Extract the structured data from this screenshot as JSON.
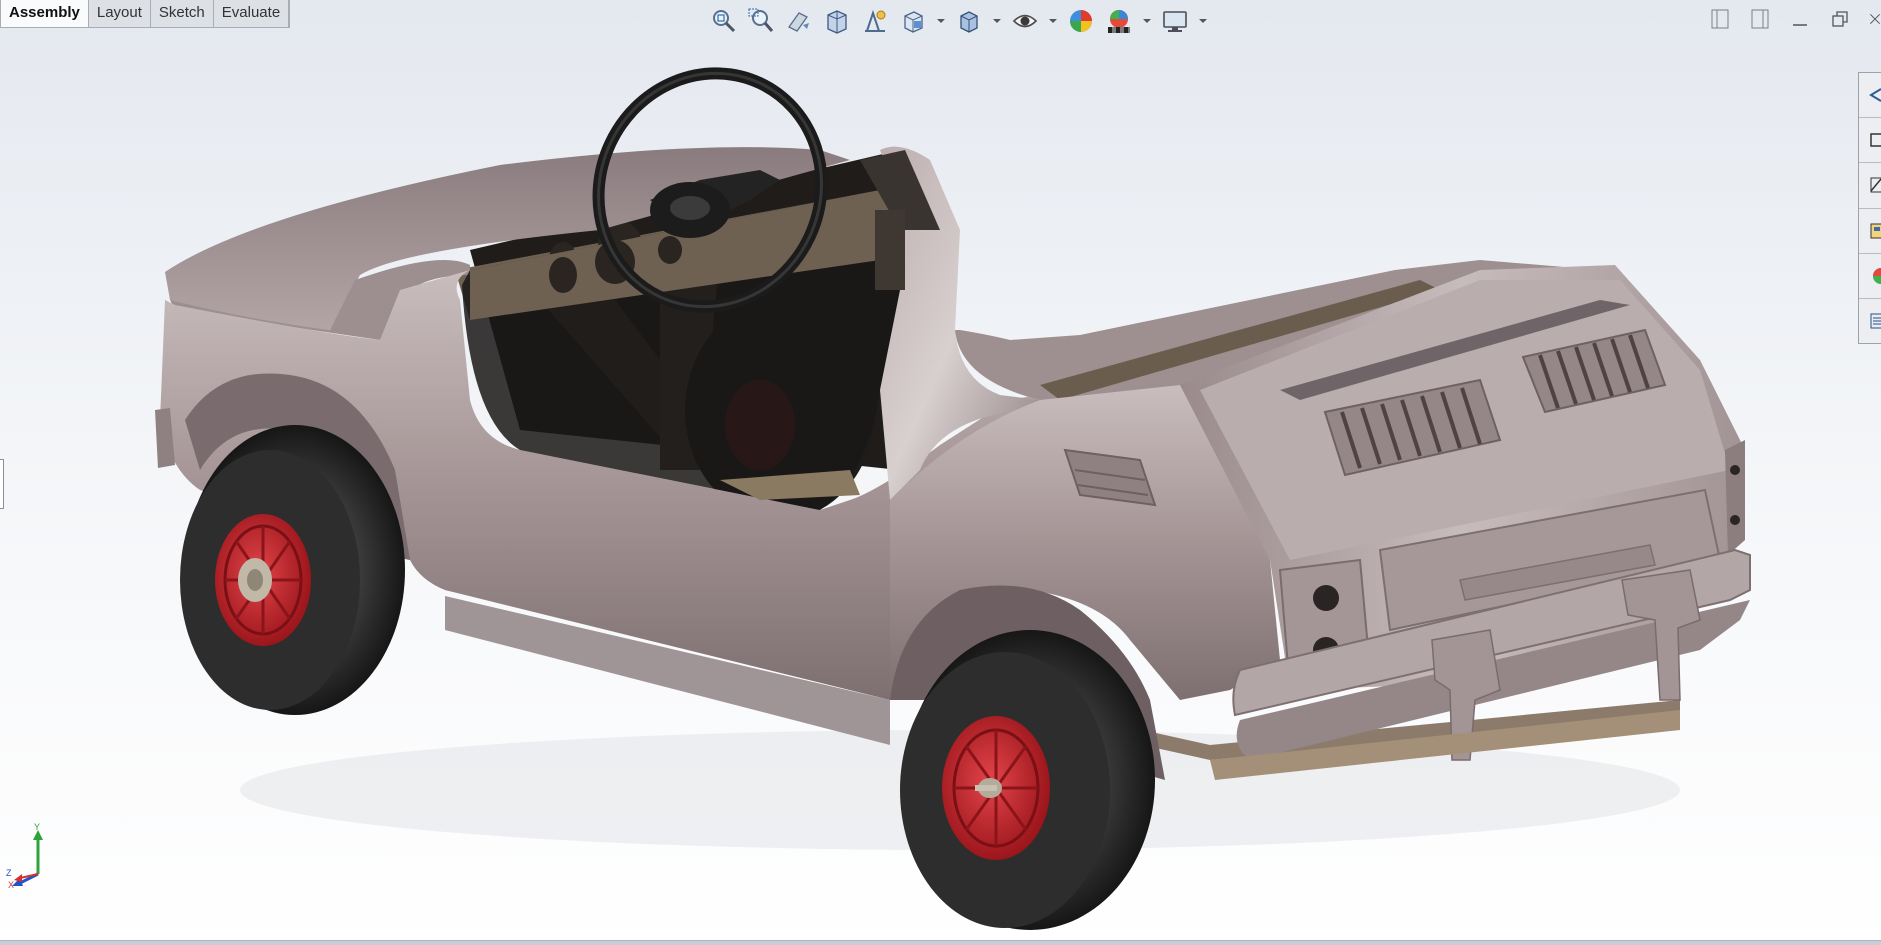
{
  "tabs": [
    {
      "label": "Assembly",
      "active": true
    },
    {
      "label": "Layout",
      "active": false
    },
    {
      "label": "Sketch",
      "active": false
    },
    {
      "label": "Evaluate",
      "active": false
    }
  ],
  "hud_tools": [
    "zoom-to-fit-icon",
    "zoom-to-area-icon",
    "previous-view-icon",
    "section-view-icon",
    "dynamic-annotation-icon",
    "view-orientation-icon",
    "display-style-icon",
    "hide-show-items-icon",
    "edit-appearance-icon",
    "apply-scene-icon",
    "view-settings-icon"
  ],
  "triad": {
    "x_label": "X",
    "y_label": "Y",
    "z_label": "Z"
  },
  "colors": {
    "body": "#a8989a",
    "rim": "#c8242a",
    "tire": "#262626",
    "wood": "#6e6152"
  }
}
